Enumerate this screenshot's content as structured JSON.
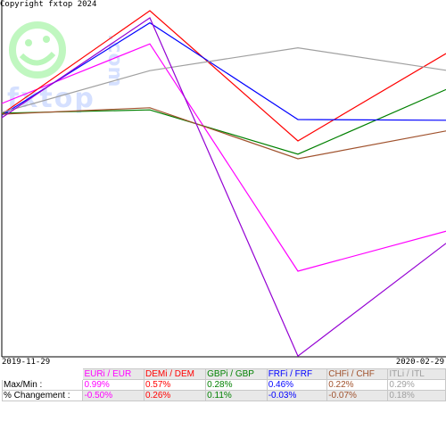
{
  "copyright": "Copyright fxtop 2024",
  "watermark": "fxtop.com",
  "dates": {
    "start": "2019-11-29",
    "end": "2020-02-29"
  },
  "table": {
    "row_labels": [
      "Max/Min :",
      "% Changement :"
    ],
    "columns": [
      {
        "header": "EURi / EUR",
        "maxmin": "0.99%",
        "change": "-0.50%",
        "color": "#ff00ff"
      },
      {
        "header": "DEMi / DEM",
        "maxmin": "0.57%",
        "change": "0.26%",
        "color": "#ff0000"
      },
      {
        "header": "GBPi / GBP",
        "maxmin": "0.28%",
        "change": "0.11%",
        "color": "#008000"
      },
      {
        "header": "FRFi / FRF",
        "maxmin": "0.46%",
        "change": "-0.03%",
        "color": "#0000ff"
      },
      {
        "header": "CHFi / CHF",
        "maxmin": "0.22%",
        "change": "-0.07%",
        "color": "#a0522d"
      },
      {
        "header": "ITLi / ITL",
        "maxmin": "0.29%",
        "change": "0.18%",
        "color": "#a0a0a0"
      }
    ]
  },
  "chart_data": {
    "type": "line",
    "x": [
      "2019-11-29",
      "2019-12-31",
      "2020-01-31",
      "2020-02-29"
    ],
    "ylim": [
      0,
      100
    ],
    "series": [
      {
        "name": "EURi / EUR",
        "color": "#ff00ff",
        "values": [
          71.0,
          87.7,
          24.0,
          35.2
        ]
      },
      {
        "name": "DEMi / DEM",
        "color": "#ff0000",
        "values": [
          68.0,
          97.0,
          60.5,
          85.0
        ]
      },
      {
        "name": "GBPi / GBP",
        "color": "#008000",
        "values": [
          68.3,
          69.2,
          56.8,
          74.9
        ]
      },
      {
        "name": "FRFi / FRF",
        "color": "#0000ff",
        "values": [
          67.7,
          93.6,
          66.5,
          66.3
        ]
      },
      {
        "name": "CHFi / CHF",
        "color": "#a0522d",
        "values": [
          68.0,
          69.8,
          55.5,
          63.3
        ]
      },
      {
        "name": "ITLi / ITL",
        "color": "#a0a0a0",
        "values": [
          68.5,
          80.2,
          86.6,
          80.3
        ]
      },
      {
        "name": "",
        "color": "#9400d3",
        "values": [
          67.0,
          95.0,
          0.2,
          31.8
        ]
      }
    ]
  }
}
